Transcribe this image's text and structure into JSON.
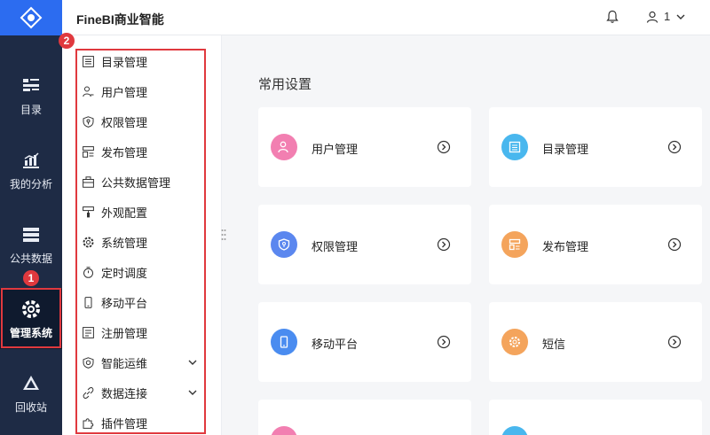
{
  "header": {
    "title": "FineBI商业智能",
    "user_label": "1"
  },
  "nav": {
    "items": [
      {
        "label": "目录",
        "icon": "catalog-icon"
      },
      {
        "label": "我的分析",
        "icon": "analysis-chart-icon"
      },
      {
        "label": "公共数据",
        "icon": "database-icon"
      },
      {
        "label": "管理系统",
        "icon": "gear-icon"
      },
      {
        "label": "回收站",
        "icon": "recycle-icon"
      }
    ],
    "active": "管理系统"
  },
  "badges": {
    "one": "1",
    "two": "2"
  },
  "submenu": {
    "items": [
      {
        "label": "目录管理",
        "icon": "list-icon"
      },
      {
        "label": "用户管理",
        "icon": "user-icon"
      },
      {
        "label": "权限管理",
        "icon": "shield-icon"
      },
      {
        "label": "发布管理",
        "icon": "publish-icon"
      },
      {
        "label": "公共数据管理",
        "icon": "briefcase-icon"
      },
      {
        "label": "外观配置",
        "icon": "brush-icon"
      },
      {
        "label": "系统管理",
        "icon": "gear-icon"
      },
      {
        "label": "定时调度",
        "icon": "timer-icon"
      },
      {
        "label": "移动平台",
        "icon": "mobile-icon"
      },
      {
        "label": "注册管理",
        "icon": "register-icon"
      },
      {
        "label": "智能运维",
        "icon": "ops-shield-icon",
        "expandable": true
      },
      {
        "label": "数据连接",
        "icon": "link-icon",
        "expandable": true
      },
      {
        "label": "插件管理",
        "icon": "puzzle-icon"
      }
    ]
  },
  "main": {
    "section_title": "常用设置",
    "cards": [
      {
        "label": "用户管理",
        "icon": "user-icon",
        "color": "#f27fb1"
      },
      {
        "label": "目录管理",
        "icon": "list-icon",
        "color": "#49b7ee"
      },
      {
        "label": "权限管理",
        "icon": "shield-icon",
        "color": "#5b87ef"
      },
      {
        "label": "发布管理",
        "icon": "publish-icon",
        "color": "#f4a45c"
      },
      {
        "label": "移动平台",
        "icon": "mobile-icon",
        "color": "#4a8cf0"
      },
      {
        "label": "短信",
        "icon": "gear-icon",
        "color": "#f4a45c"
      }
    ]
  },
  "colors": {
    "nav_bg": "#1e2b45",
    "logo_bg": "#2c6cf0",
    "highlight": "#e0393e"
  }
}
